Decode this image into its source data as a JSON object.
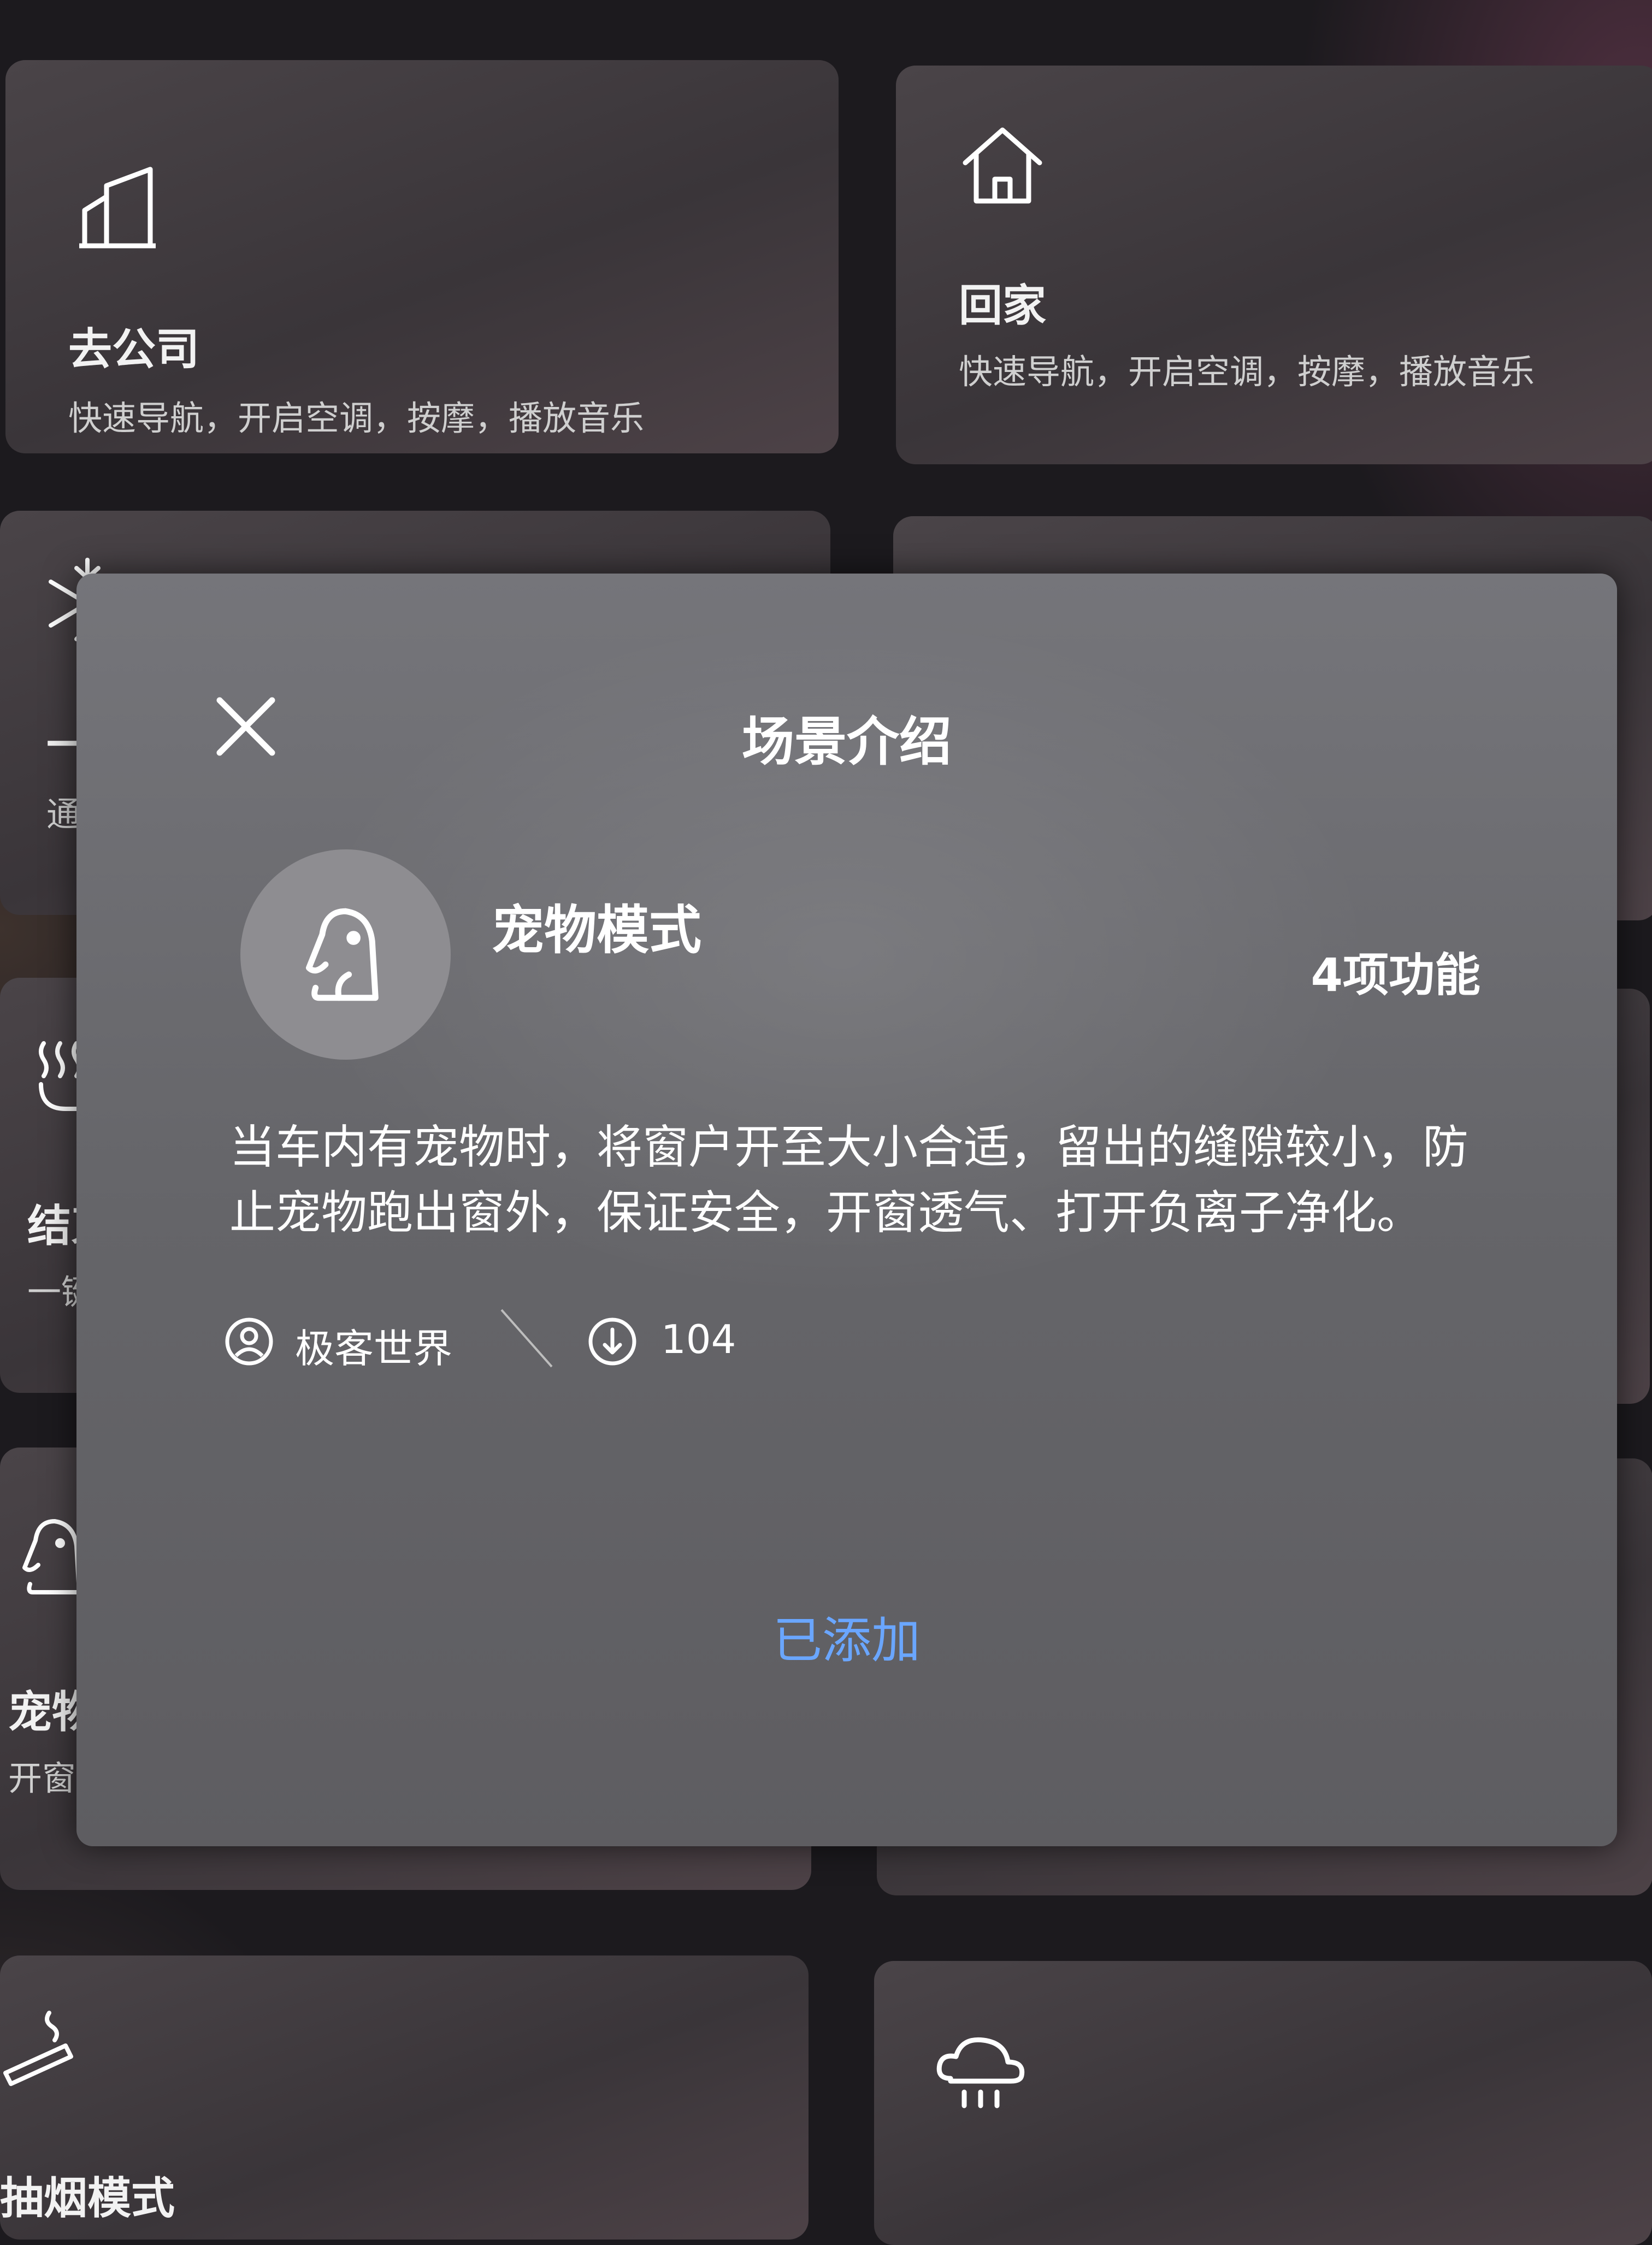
{
  "cards": {
    "go_to_work": {
      "title": "去公司",
      "desc": "快速导航，开启空调，按摩，播放音乐",
      "icon": "building-icon"
    },
    "go_home": {
      "title": "回家",
      "desc": "快速导航，开启空调，按摩，播放音乐",
      "icon": "home-icon"
    },
    "one_key_cool": {
      "title": "一键",
      "desc": "通过",
      "icon": "snowflake-icon"
    },
    "finish": {
      "title": "结束",
      "desc": "一键",
      "icon": "heat-seat-icon"
    },
    "pet": {
      "title": "宠物",
      "desc": "开窗",
      "icon": "dog-icon"
    },
    "smoking": {
      "title": "抽烟模式",
      "icon": "cigarette-icon"
    },
    "rain": {
      "icon": "rain-cloud-icon"
    }
  },
  "modal": {
    "title": "场景介绍",
    "close_icon": "close-icon",
    "scene_icon": "dog-icon",
    "scene_name": "宠物模式",
    "feature_count": "4项功能",
    "description": "当车内有宠物时，将窗户开至大小合适，留出的缝隙较小，防止宠物跑出窗外，保证安全，开窗透气、打开负离子净化。",
    "author_icon": "user-icon",
    "author": "极客世界",
    "download_icon": "download-icon",
    "downloads": "104",
    "action_label": "已添加",
    "action_color": "#6aa6ff"
  }
}
